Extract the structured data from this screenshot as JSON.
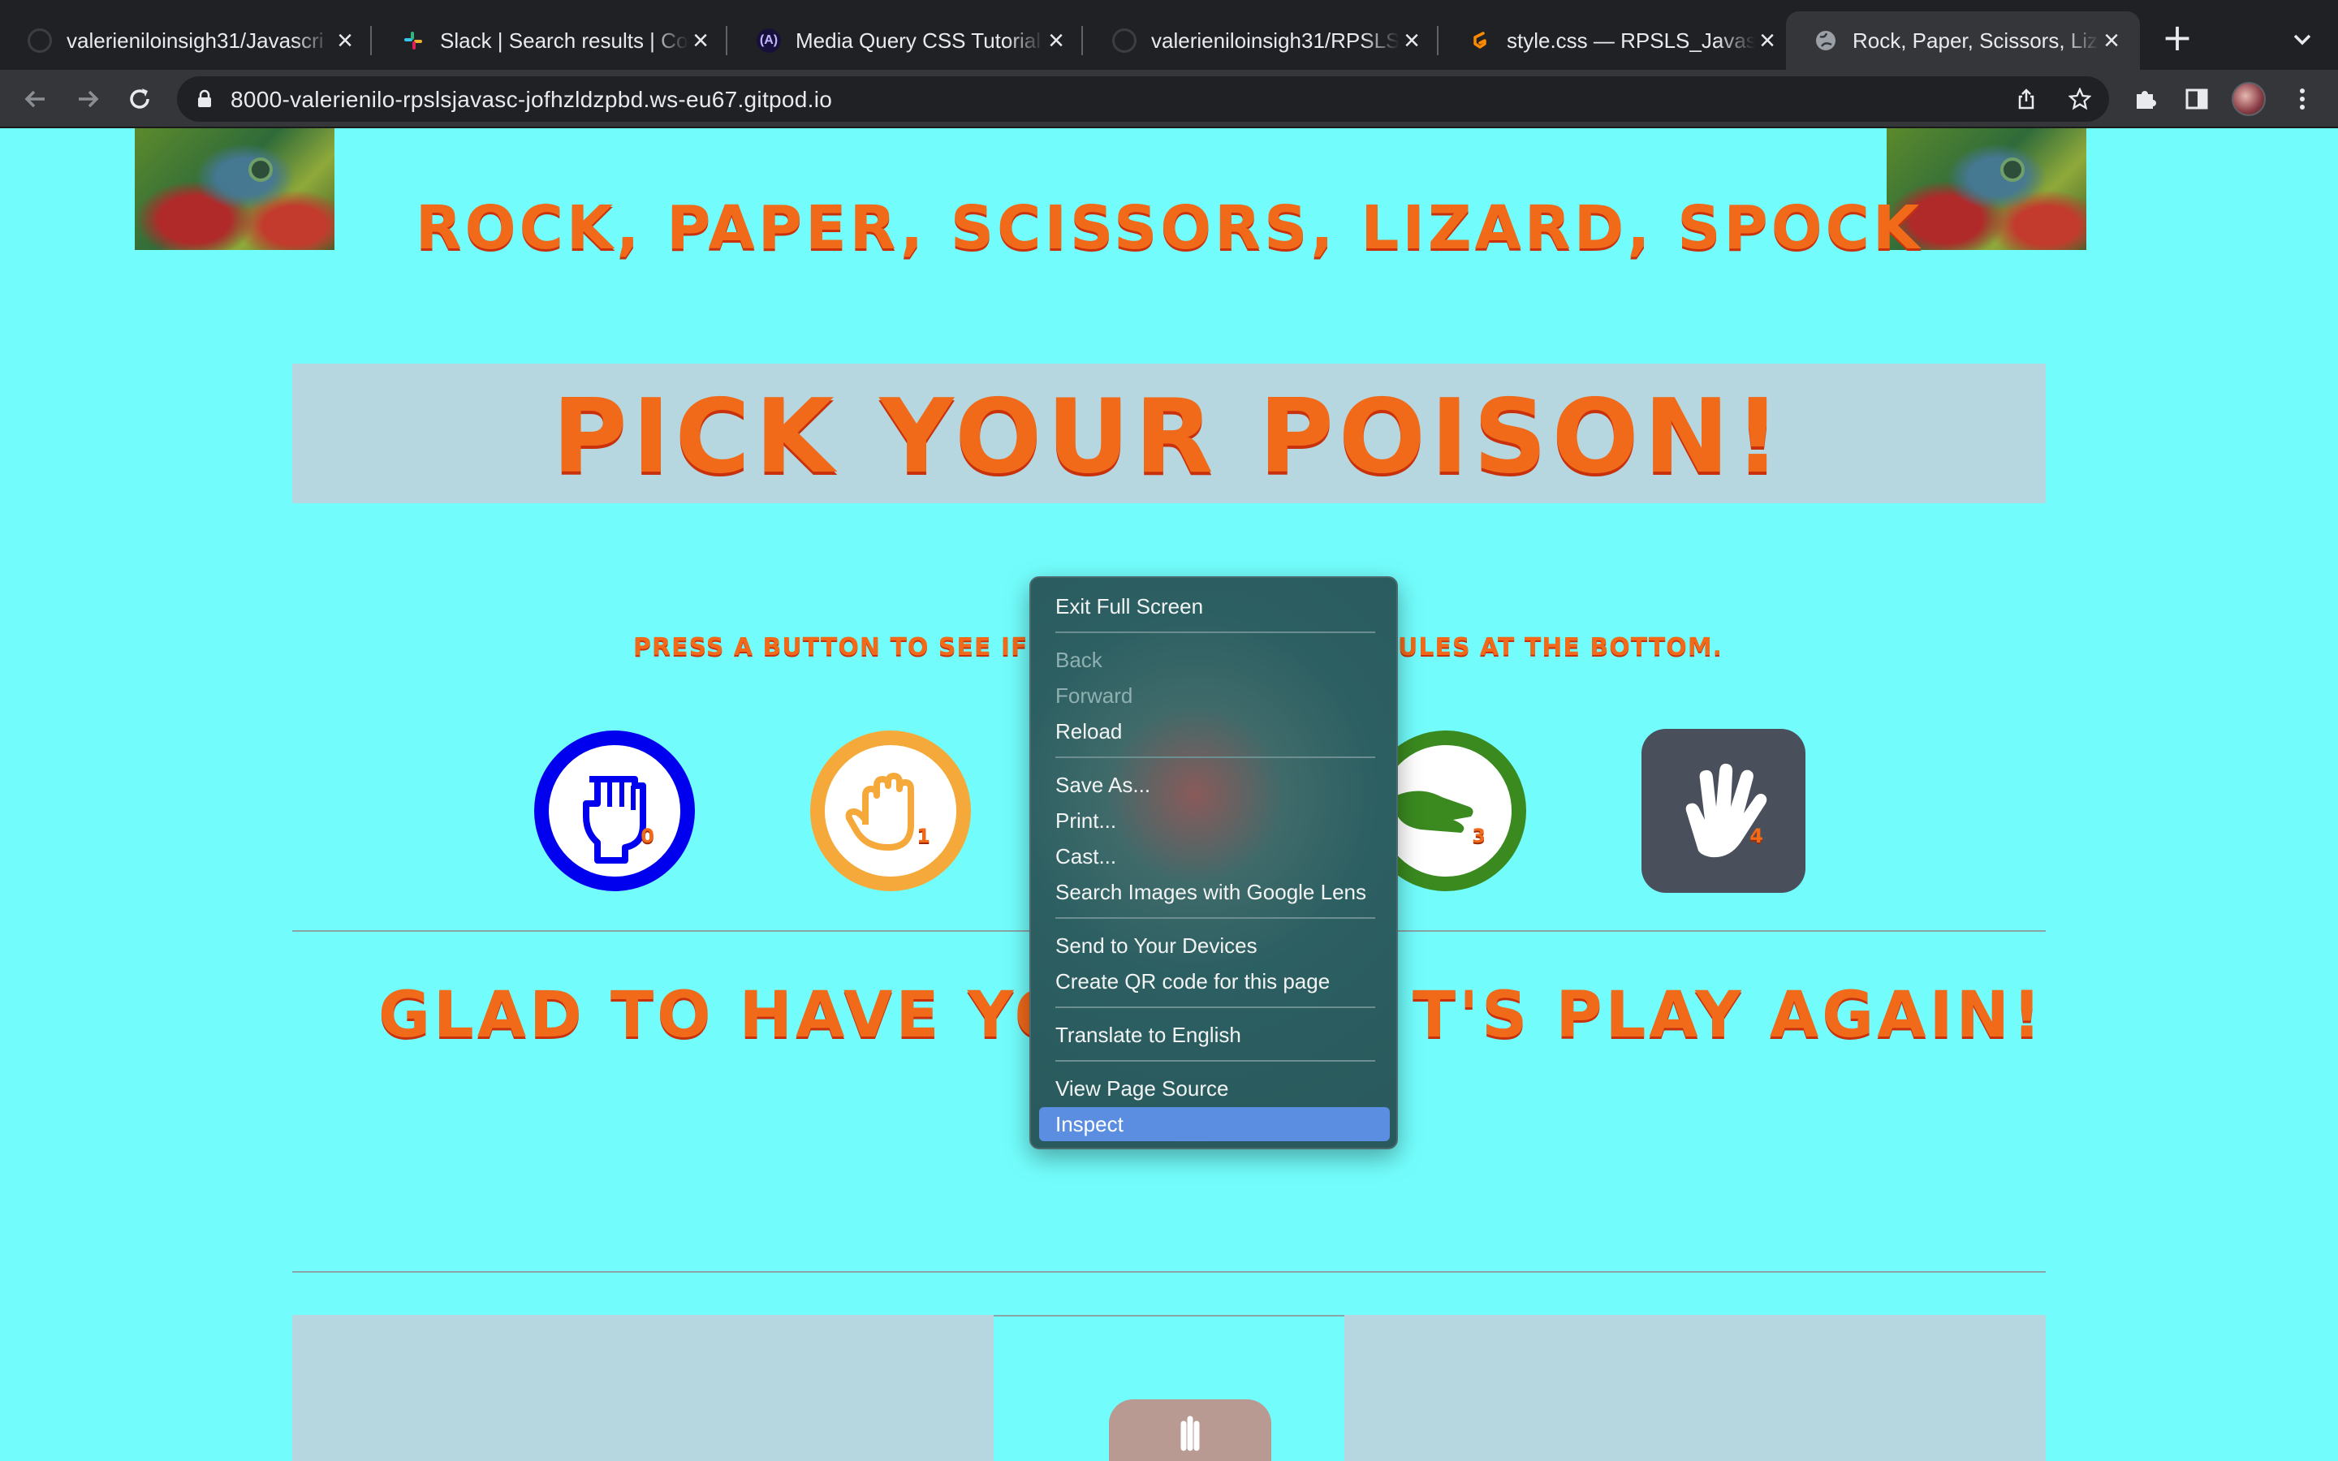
{
  "browser": {
    "tabs": [
      {
        "title": "valerieniloinsigh31/Javascri",
        "favicon": "github-icon"
      },
      {
        "title": "Slack | Search results | Cod",
        "favicon": "slack-icon"
      },
      {
        "title": "Media Query CSS Tutorial –",
        "favicon": "astro-icon"
      },
      {
        "title": "valerieniloinsigh31/RPSLS_",
        "favicon": "github-icon"
      },
      {
        "title": "style.css — RPSLS_Javascr",
        "favicon": "gitpod-icon"
      },
      {
        "title": "Rock, Paper, Scissors, Lizar",
        "favicon": "globe-icon",
        "active": true
      }
    ],
    "url": "8000-valerienilo-rpslsjavasc-jofhzldzpbd.ws-eu67.gitpod.io"
  },
  "page": {
    "title": "ROCK, PAPER, SCISSORS, LIZARD, SPOCK",
    "banner": "PICK YOUR POISON!",
    "instructions_left": "PRESS A BUTTON TO SEE IF YO",
    "instructions_right": "ULES AT THE BOTTOM.",
    "choices": [
      {
        "name": "rock",
        "number": "0",
        "color": "#0000ee"
      },
      {
        "name": "paper",
        "number": "1",
        "color": "#f5a93a"
      },
      {
        "name": "lizard",
        "number": "3",
        "color": "#3a8a20"
      },
      {
        "name": "spock",
        "number": "4",
        "color": "#4a4f5c"
      }
    ],
    "result_left": "GLAD TO HAVE YOU",
    "result_right": "T'S PLAY AGAIN!"
  },
  "context_menu": {
    "items": [
      {
        "label": "Exit Full Screen"
      },
      {
        "label": "Back",
        "disabled": true
      },
      {
        "label": "Forward",
        "disabled": true
      },
      {
        "label": "Reload"
      },
      {
        "label": "Save As..."
      },
      {
        "label": "Print..."
      },
      {
        "label": "Cast..."
      },
      {
        "label": "Search Images with Google Lens"
      },
      {
        "label": "Send to Your Devices"
      },
      {
        "label": "Create QR code for this page"
      },
      {
        "label": "Translate to English"
      },
      {
        "label": "View Page Source"
      },
      {
        "label": "Inspect",
        "highlighted": true
      }
    ]
  },
  "colors": {
    "page_bg": "#72fdfc",
    "title_orange": "#f06a1a",
    "banner_bg": "#b6d7e0",
    "menu_highlight": "#5b8ee0"
  }
}
